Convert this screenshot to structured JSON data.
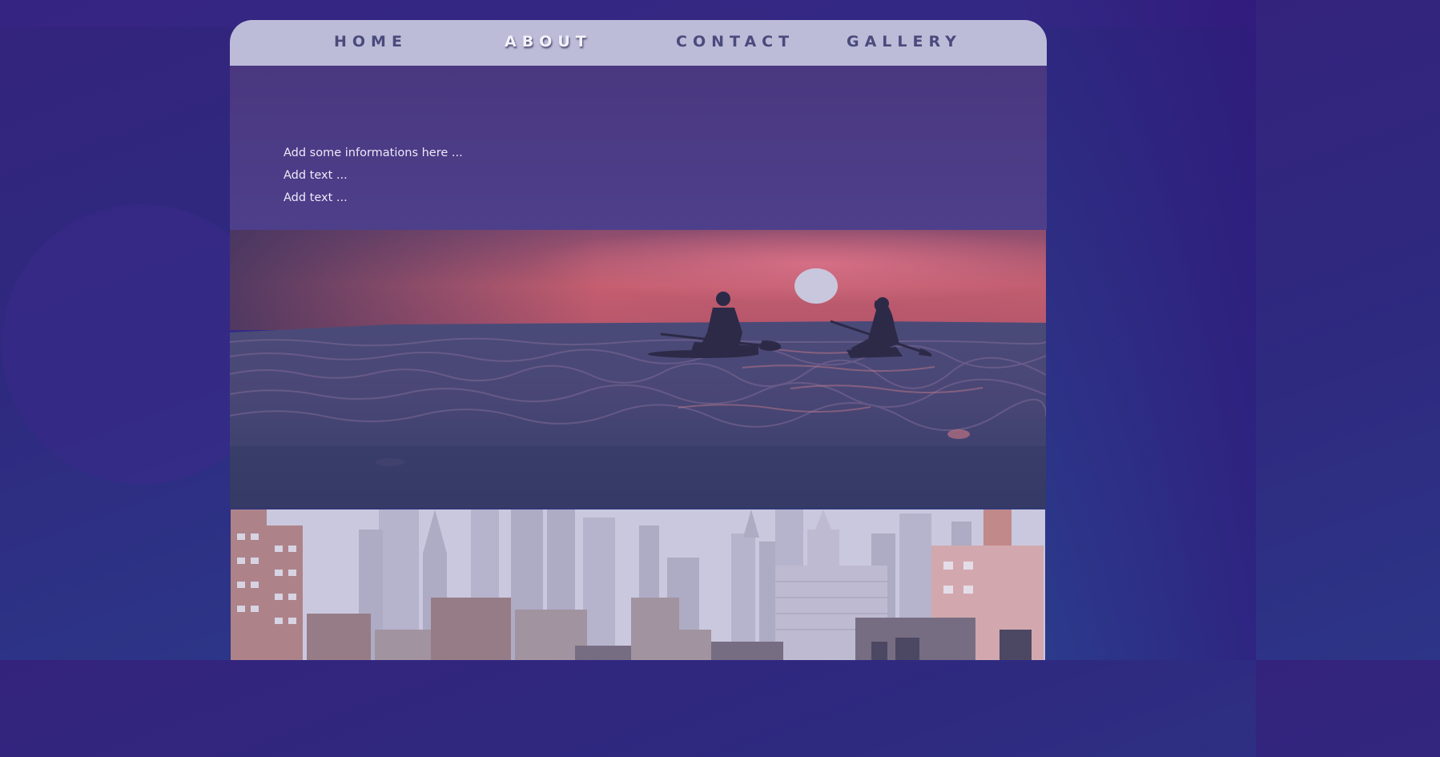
{
  "nav": {
    "items": [
      {
        "label": "HOME",
        "active": false
      },
      {
        "label": "ABOUT",
        "active": true
      },
      {
        "label": "CONTACT",
        "active": false
      },
      {
        "label": "GALLERY",
        "active": false
      }
    ]
  },
  "info": {
    "lines": [
      "Add some informations here ...",
      "Add text ...",
      "Add text ..."
    ]
  },
  "images": {
    "sea": {
      "subject": "two paddleboarders silhouetted on the sea at sunset"
    },
    "city": {
      "subject": "city skyline with skyscrapers and rooftops"
    }
  },
  "colors": {
    "background": "#2f2a80",
    "navbar": "#bcbcd9",
    "nav_text": "#4b4a7c",
    "nav_active_text": "#f2f2fb",
    "info_panel": "#4d3c88",
    "info_text": "#ecebf7"
  }
}
